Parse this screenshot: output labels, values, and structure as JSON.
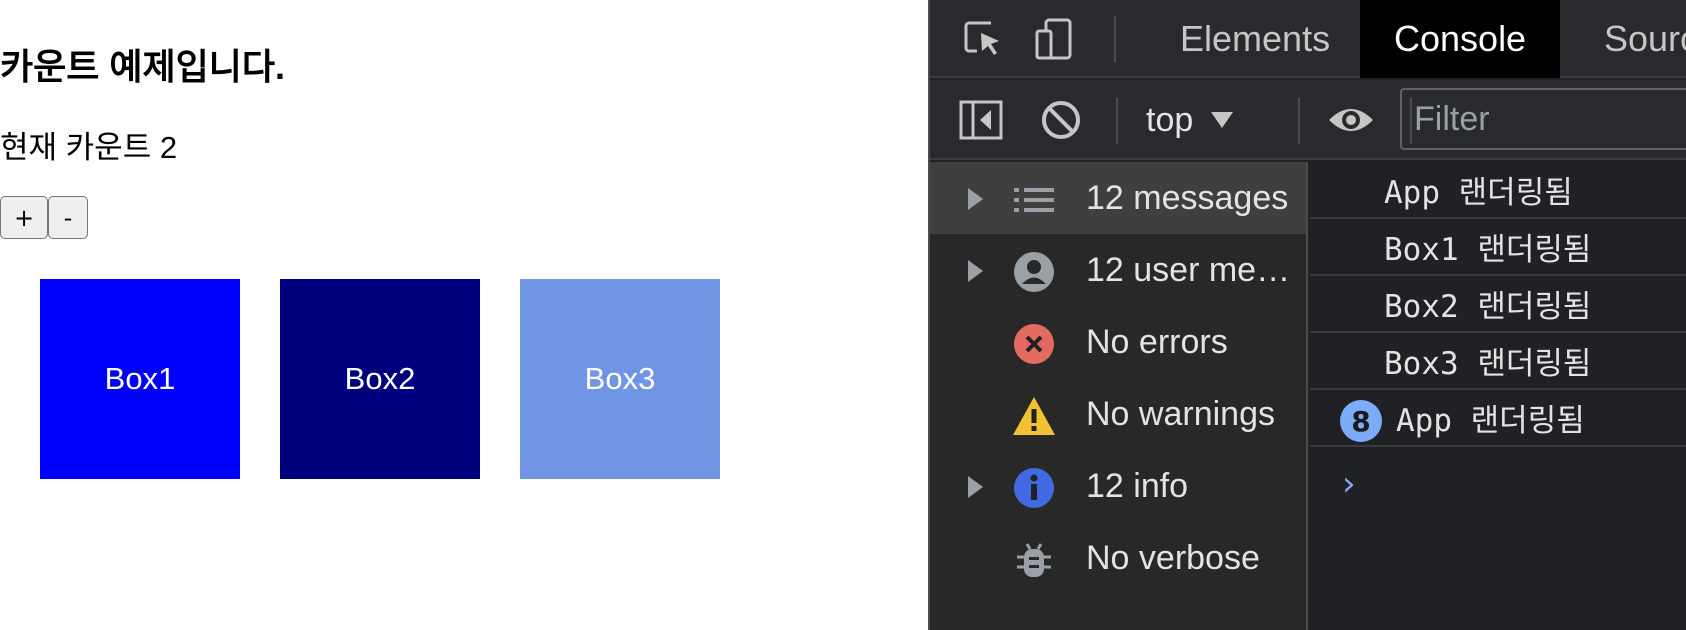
{
  "app": {
    "title": "카운트 예제입니다.",
    "count_line": "현재 카운트 2",
    "plus_label": "+",
    "minus_label": "-",
    "boxes": [
      {
        "label": "Box1",
        "color": "#0000ff"
      },
      {
        "label": "Box2",
        "color": "#00007f"
      },
      {
        "label": "Box3",
        "color": "#6f95e4"
      }
    ]
  },
  "devtools": {
    "tabs": [
      "Elements",
      "Console",
      "Sourc"
    ],
    "active_tab": "Console",
    "context_select": "top",
    "filter_placeholder": "Filter",
    "sidebar": [
      {
        "label": "12 messages",
        "icon": "list-icon",
        "expandable": true,
        "selected": true
      },
      {
        "label": "12 user me…",
        "icon": "user-icon",
        "expandable": true,
        "selected": false
      },
      {
        "label": "No errors",
        "icon": "error-icon",
        "expandable": false,
        "selected": false
      },
      {
        "label": "No warnings",
        "icon": "warning-icon",
        "expandable": false,
        "selected": false
      },
      {
        "label": "12 info",
        "icon": "info-icon",
        "expandable": true,
        "selected": false
      },
      {
        "label": "No verbose",
        "icon": "bug-icon",
        "expandable": false,
        "selected": false
      }
    ],
    "logs": [
      {
        "text": "App 랜더링됨"
      },
      {
        "text": "Box1 랜더링됨"
      },
      {
        "text": "Box2 랜더링됨"
      },
      {
        "text": "Box3 랜더링됨"
      },
      {
        "text": "App 랜더링됨",
        "repeat": "8"
      }
    ],
    "prompt": "›",
    "colors": {
      "panel_bg": "#202124",
      "toolbar_bg": "#292a2d",
      "accent": "#7cacf8",
      "error": "#e46962",
      "warning": "#f2c230",
      "info": "#4169e1"
    }
  }
}
